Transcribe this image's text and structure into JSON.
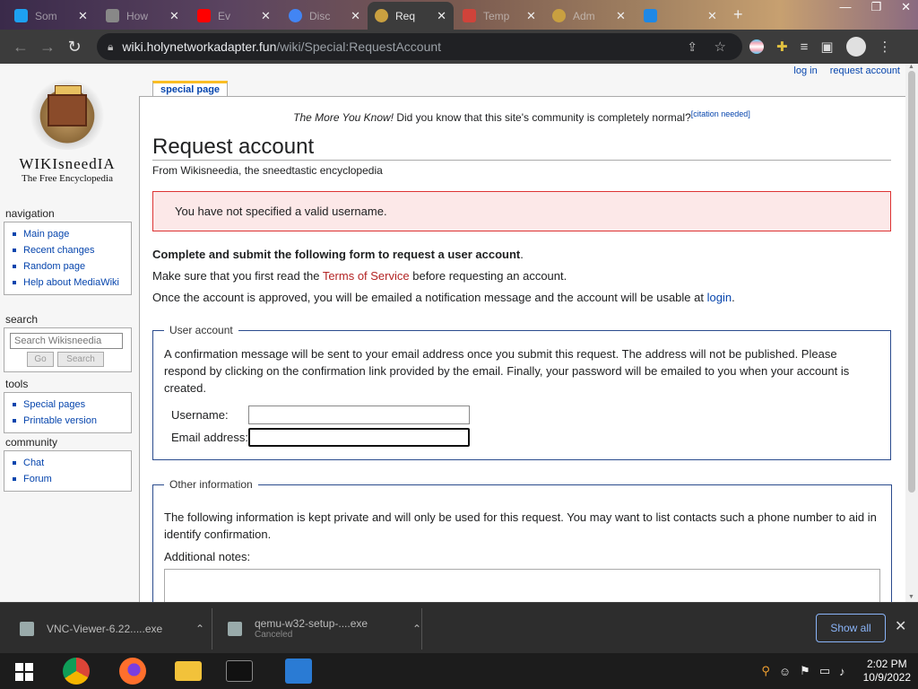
{
  "browser": {
    "tabs": [
      {
        "label": "Som",
        "fav_color": "#1da1f2"
      },
      {
        "label": "How",
        "fav_color": "#888888"
      },
      {
        "label": "Ev",
        "fav_color": "#ff0000"
      },
      {
        "label": "Disc",
        "fav_color": "#4285f4"
      },
      {
        "label": "Req",
        "fav_color": "#c9a040",
        "active": true
      },
      {
        "label": "Temp",
        "fav_color": "#d0433a"
      },
      {
        "label": "Adm",
        "fav_color": "#c9a040"
      },
      {
        "label": "",
        "fav_color": "#1e88e5"
      }
    ],
    "address": {
      "host": "wiki.holynetworkadapter.fun",
      "path": "/wiki/Special:RequestAccount"
    }
  },
  "wiki": {
    "personal": {
      "login": "log in",
      "request": "request account"
    },
    "logo": {
      "wordmark": "WIKIsneedIA",
      "tagline": "The Free Encyclopedia"
    },
    "navigation": {
      "heading": "navigation",
      "items": [
        "Main page",
        "Recent changes",
        "Random page",
        "Help about MediaWiki"
      ]
    },
    "search": {
      "heading": "search",
      "placeholder": "Search Wikisneedia",
      "go": "Go",
      "search": "Search"
    },
    "tools": {
      "heading": "tools",
      "items": [
        "Special pages",
        "Printable version"
      ]
    },
    "community": {
      "heading": "community",
      "items": [
        "Chat",
        "Forum"
      ]
    },
    "page_tab": "special page",
    "sitenotice": {
      "em": "The More You Know!",
      "text": " Did you know that this site's community is completely normal?",
      "cite": "[citation needed]"
    },
    "title": "Request account",
    "subtitle": "From Wikisneedia, the sneedtastic encyclopedia",
    "error": "You have not specified a valid username.",
    "intro_bold": "Complete and submit the following form to request a user account",
    "intro_end": ".",
    "tos_pre": "Make sure that you first read the ",
    "tos_link": "Terms of Service",
    "tos_post": " before requesting an account.",
    "approve_pre": "Once the account is approved, you will be emailed a notification message and the account will be usable at ",
    "approve_link": "login",
    "approve_post": ".",
    "user_account": {
      "legend": "User account",
      "text": "A confirmation message will be sent to your email address once you submit this request. The address will not be published. Please respond by clicking on the confirmation link provided by the email. Finally, your password will be emailed to you when your account is created.",
      "username_label": "Username:",
      "username_value": "",
      "email_label": "Email address:",
      "email_value": ""
    },
    "other": {
      "legend": "Other information",
      "text": "The following information is kept private and will only be used for this request. You may want to list contacts such a phone number to aid in identify confirmation.",
      "notes_label": "Additional notes:"
    }
  },
  "downloads": {
    "items": [
      {
        "name": "VNC-Viewer-6.22.....exe",
        "status": ""
      },
      {
        "name": "qemu-w32-setup-....exe",
        "status": "Canceled"
      }
    ],
    "show_all": "Show all"
  },
  "taskbar": {
    "time": "2:02 PM",
    "date": "10/9/2022"
  }
}
